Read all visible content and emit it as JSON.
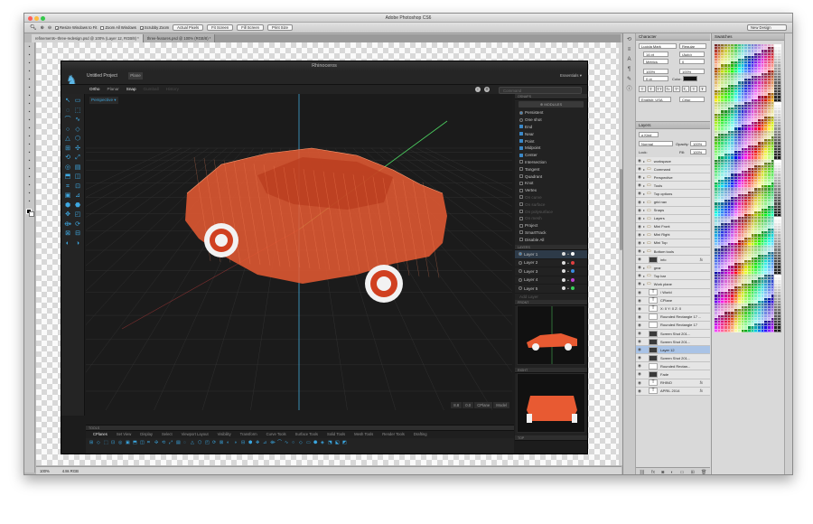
{
  "app": {
    "title": "Adobe Photoshop CS6",
    "workspace": "New Design"
  },
  "options_bar": {
    "resize_windows": "Resize Windows to Fit",
    "zoom_all": "Zoom All Windows",
    "scrubby_zoom": "Scrubby Zoom",
    "actual_pixels": "Actual Pixels",
    "fit_screen": "Fit Screen",
    "fill_screen": "Fill Screen",
    "print_size": "Print Size"
  },
  "doc_tabs": [
    {
      "label": "refinements--three-redesign.psd @ 100% (Layer 12, RGB/8) *"
    },
    {
      "label": "three-features.psd @ 100% (RGB/8) *"
    }
  ],
  "status": {
    "zoom": "100%",
    "info": "4.8s  RGB"
  },
  "rhino": {
    "title": "Rhinoceros",
    "project": "Untitled Project",
    "project_tab": "Plane",
    "essentials": "Essentials",
    "modes": [
      {
        "label": "Ortho",
        "state": "on"
      },
      {
        "label": "Planar",
        "state": "off"
      },
      {
        "label": "Snap",
        "state": "on"
      },
      {
        "label": "Gumball",
        "state": "dim"
      },
      {
        "label": "History",
        "state": "dim"
      }
    ],
    "search_placeholder": "Command",
    "viewport_label": "Perspective ▾",
    "viewport_status": [
      "8.8",
      "0.0",
      "CPlane",
      "Model"
    ],
    "osnap": {
      "header": "OSNAPS",
      "button": "MODULES",
      "modes": [
        {
          "label": "Persistent",
          "kind": "radio",
          "on": true
        },
        {
          "label": "One shot",
          "kind": "radio",
          "on": false
        },
        {
          "label": "End",
          "kind": "check",
          "on": true
        },
        {
          "label": "Near",
          "kind": "check",
          "on": true
        },
        {
          "label": "Point",
          "kind": "check",
          "on": true
        },
        {
          "label": "Midpoint",
          "kind": "check",
          "on": true
        },
        {
          "label": "Center",
          "kind": "check",
          "on": true
        },
        {
          "label": "Intersection",
          "kind": "check",
          "on": false
        },
        {
          "label": "Tangent",
          "kind": "check",
          "on": false
        },
        {
          "label": "Quadrant",
          "kind": "check",
          "on": false
        },
        {
          "label": "Knot",
          "kind": "check",
          "on": false
        },
        {
          "label": "Vertex",
          "kind": "check",
          "on": false
        },
        {
          "label": "On curve",
          "kind": "check",
          "on": false,
          "dim": true
        },
        {
          "label": "On surface",
          "kind": "check",
          "on": false,
          "dim": true
        },
        {
          "label": "On polysurface",
          "kind": "check",
          "on": false,
          "dim": true
        },
        {
          "label": "On mesh",
          "kind": "check",
          "on": false,
          "dim": true
        },
        {
          "label": "Project",
          "kind": "check",
          "on": false
        },
        {
          "label": "SmartTrack",
          "kind": "check",
          "on": false
        },
        {
          "label": "Disable All",
          "kind": "check",
          "on": false
        }
      ]
    },
    "layers": {
      "header": "LAYERS",
      "items": [
        {
          "name": "Layer 1",
          "color": "#ffffff",
          "current": true
        },
        {
          "name": "Layer 2",
          "color": "#e04040"
        },
        {
          "name": "Layer 3",
          "color": "#3a8de0"
        },
        {
          "name": "Layer 4",
          "color": "#c040d0"
        },
        {
          "name": "Layer 5",
          "color": "#3ad05a"
        }
      ],
      "add": "Add Layer"
    },
    "preview_labels": [
      "FRONT",
      "RIGHT",
      "TOP"
    ],
    "cmd_tabs": [
      "CPlanes",
      "Set View",
      "Display",
      "Select",
      "Viewport Layout",
      "Visibility",
      "Transform",
      "Curve Tools",
      "Surface Tools",
      "Solid Tools",
      "Mesh Tools",
      "Render Tools",
      "Drafting"
    ],
    "cmd_header": "TOOLS"
  },
  "character": {
    "tab": "Character",
    "font": "Lucida Mark",
    "style": "Regular",
    "size": "14 pt",
    "leading": "(Auto)",
    "kerning": "Metrics",
    "tracking": "0",
    "vscale": "100%",
    "hscale": "100%",
    "baseline": "0 pt",
    "color_label": "Color:",
    "lang": "English: USA",
    "aa": "Crisp",
    "buttons": [
      "T",
      "T",
      "TT",
      "Tr",
      "T¹",
      "T₁",
      "T",
      "Ŧ"
    ]
  },
  "layers": {
    "tab": "Layers",
    "kind": "Kind",
    "blend": "Normal",
    "opacity_label": "Opacity:",
    "opacity": "100%",
    "lock_label": "Lock:",
    "fill_label": "Fill:",
    "fill": "100%",
    "items": [
      {
        "name": "workspace",
        "type": "folder"
      },
      {
        "name": "Command",
        "type": "folder"
      },
      {
        "name": "Perspective",
        "type": "folder"
      },
      {
        "name": "Tools",
        "type": "folder"
      },
      {
        "name": "Top options",
        "type": "folder"
      },
      {
        "name": "grid nav",
        "type": "folder"
      },
      {
        "name": "Snaps",
        "type": "folder"
      },
      {
        "name": "Layers",
        "type": "folder"
      },
      {
        "name": "Mini Front",
        "type": "folder"
      },
      {
        "name": "Mini Right",
        "type": "folder"
      },
      {
        "name": "Mini Top",
        "type": "folder"
      },
      {
        "name": "Bottom tools",
        "type": "folder"
      },
      {
        "name": "info",
        "type": "image",
        "fx": true
      },
      {
        "name": "gear",
        "type": "folder"
      },
      {
        "name": "Top bar",
        "type": "folder"
      },
      {
        "name": "Work plane",
        "type": "folder"
      },
      {
        "name": "/ World",
        "type": "text"
      },
      {
        "name": "CPlane",
        "type": "text"
      },
      {
        "name": "X: 0 Y: 0 Z: 0",
        "type": "text"
      },
      {
        "name": "Rounded Rectangle 17 ...",
        "type": "shape"
      },
      {
        "name": "Rounded Rectangle 17",
        "type": "shape"
      },
      {
        "name": "Screen Shot 201...",
        "type": "image"
      },
      {
        "name": "Screen Shot 201...",
        "type": "image"
      },
      {
        "name": "Layer 12",
        "type": "image",
        "selected": true
      },
      {
        "name": "Screen Shot 201...",
        "type": "image"
      },
      {
        "name": "Rounded Rectan...",
        "type": "shape"
      },
      {
        "name": "Fade",
        "type": "image"
      },
      {
        "name": "RHINO",
        "type": "text",
        "fx": true
      },
      {
        "name": "APRIL 2014",
        "type": "text",
        "fx": true
      }
    ]
  },
  "swatches": {
    "tab": "Swatches"
  },
  "colors": {
    "accent": "#3ea7e0",
    "car": "#e85a32",
    "selection": "#a9c3e6"
  }
}
